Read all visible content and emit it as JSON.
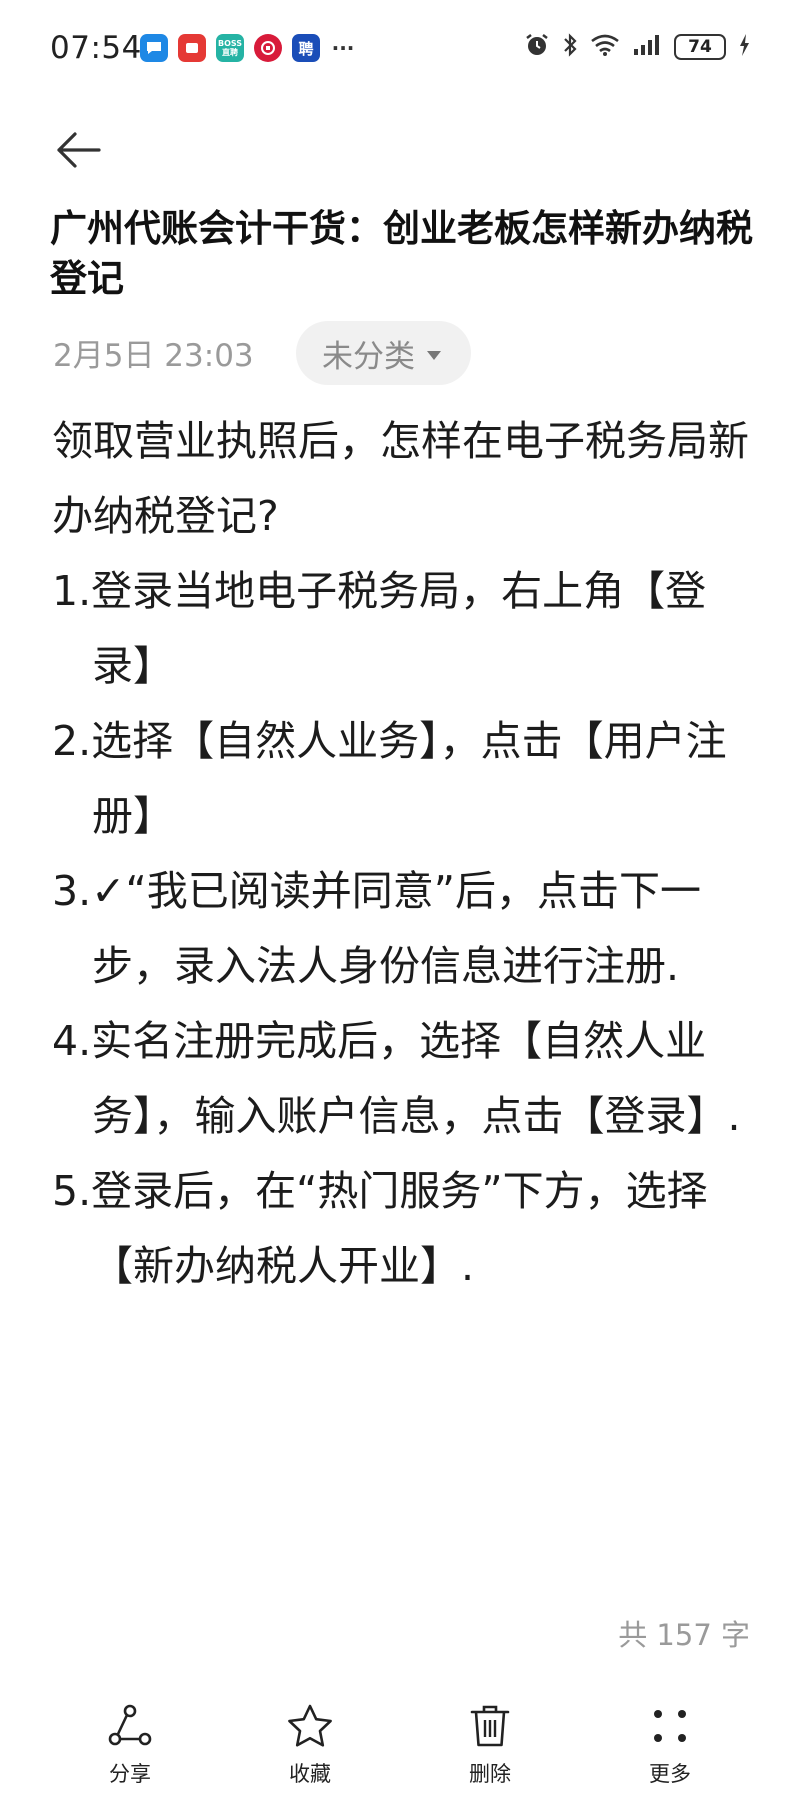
{
  "status_bar": {
    "time": "07:54",
    "notifications": [
      "chat-app",
      "red-app",
      "boss",
      "bank-app",
      "pin"
    ],
    "boss_label": "BOSS\n直聘",
    "pin_label": "聘",
    "more": "···",
    "battery": "74"
  },
  "note": {
    "title": "广州代账会计干货：创业老板怎样新办纳税登记",
    "date": "2月5日 23:03",
    "category": "未分类",
    "intro": "领取营业执照后，怎样在电子税务局新办纳税登记?",
    "steps": [
      "1.登录当地电子税务局，右上角【登录】",
      "2.选择【自然人业务】，点击【用户注册】",
      "3.✓“我已阅读并同意”后，点击下一步，录入法人身份信息进行注册.",
      "4.实名注册完成后，选择【自然人业务】，输入账户信息，点击【登录】.",
      "5.登录后，在“热门服务”下方，选择【新办纳税人开业】."
    ],
    "word_count": "共 157 字"
  },
  "toolbar": {
    "share": "分享",
    "favorite": "收藏",
    "delete": "删除",
    "more": "更多"
  },
  "colors": {
    "text": "#1c1c1c",
    "muted": "#9a9a9a",
    "chip_bg": "#f1f1f1"
  }
}
